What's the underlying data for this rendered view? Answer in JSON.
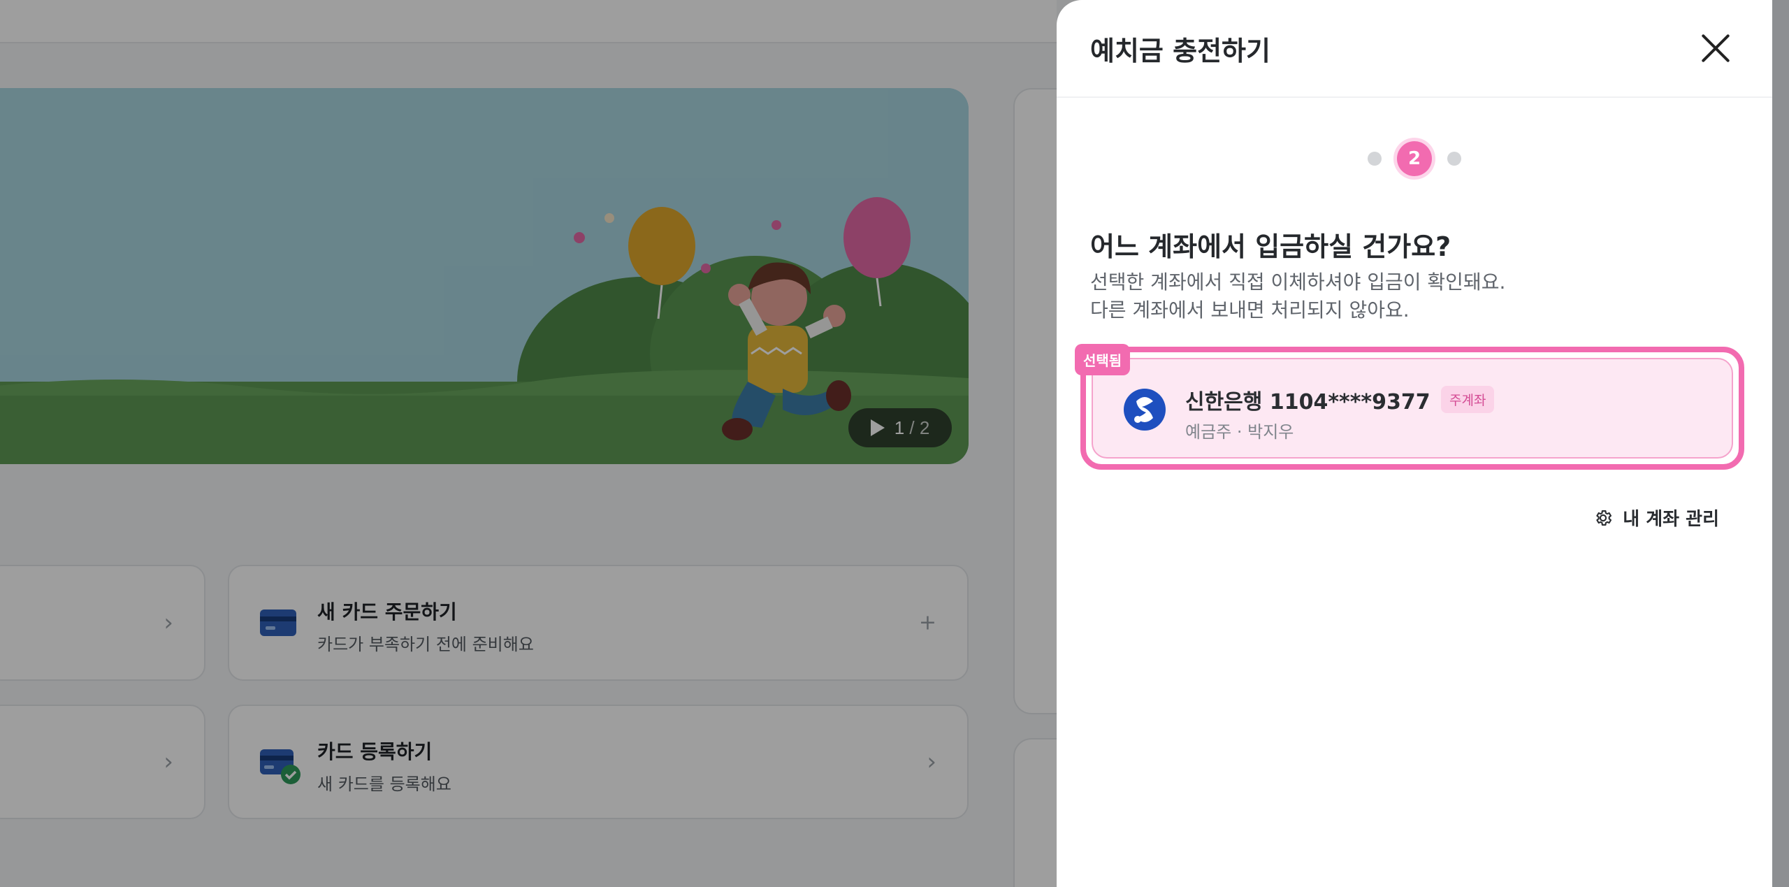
{
  "banner": {
    "slide_current": "1",
    "slide_total": "/ 2"
  },
  "cards": [
    {
      "title": "새 카드 주문하기",
      "subtitle": "카드가 부족하기 전에 준비해요",
      "action": "+"
    },
    {
      "title": "카드 등록하기",
      "subtitle": "새 카드를 등록해요",
      "action": "›"
    }
  ],
  "drawer": {
    "title": "예치금 충전하기",
    "step_active": "2",
    "question": "어느 계좌에서 입금하실 건가요?",
    "description_line1": "선택한 계좌에서 직접 이체하셔야 입금이 확인돼요.",
    "description_line2": "다른 계좌에서 보내면 처리되지 않아요.",
    "account": {
      "selected_label": "선택됨",
      "name": "신한은행 1104****9377",
      "tag": "주계좌",
      "sub": "예금주 · 박지우"
    },
    "manage_label": "내 계좌 관리"
  },
  "colors": {
    "accent": "#f26bb0",
    "accent_light": "#fde8f3",
    "bank": "#1e4fbf"
  },
  "icons": [
    "close-icon",
    "gear-icon",
    "play-icon",
    "card-icon",
    "card-check-icon",
    "shinhan-logo-icon",
    "chevron-right-icon",
    "plus-icon"
  ]
}
